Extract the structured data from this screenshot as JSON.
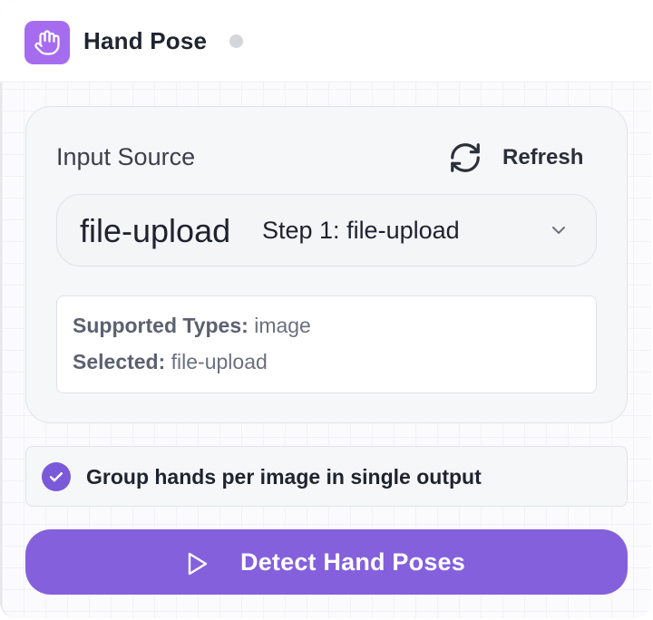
{
  "node": {
    "title": "Hand Pose",
    "icon": "hand-icon",
    "accent_color": "#a66cf0",
    "status": "idle"
  },
  "input_source": {
    "label": "Input Source",
    "refresh_label": "Refresh",
    "refresh_icon": "refresh-icon",
    "selected_name": "file-upload",
    "selected_step": "Step 1: file-upload"
  },
  "info": {
    "supported_label": "Supported Types:",
    "supported_value": "image",
    "selected_label": "Selected:",
    "selected_value": "file-upload"
  },
  "options": {
    "group_hands_label": "Group hands per image in single output",
    "group_hands_checked": true
  },
  "action": {
    "detect_label": "Detect Hand Poses",
    "button_color": "#8460dd"
  }
}
